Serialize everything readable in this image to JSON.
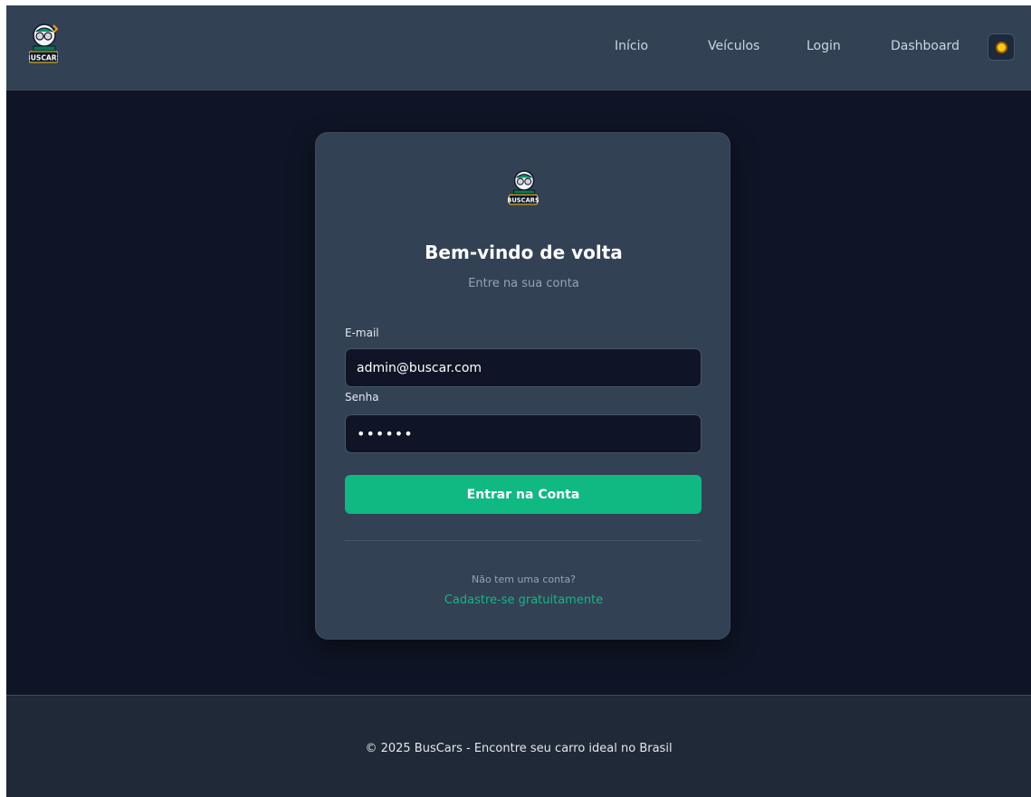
{
  "brand": {
    "logo_text": "BUSCARS"
  },
  "nav": {
    "items": [
      {
        "label": "Início"
      },
      {
        "label": "Veículos"
      },
      {
        "label": "Login"
      },
      {
        "label": "Dashboard"
      }
    ],
    "theme_icon": "sun-icon"
  },
  "login": {
    "title": "Bem-vindo de volta",
    "subtitle": "Entre na sua conta",
    "email_label": "E-mail",
    "email_value": "admin@buscar.com",
    "password_label": "Senha",
    "password_value": "••••••",
    "submit_label": "Entrar na Conta",
    "no_account_text": "Não tem uma conta?",
    "signup_link": "Cadastre-se gratuitamente"
  },
  "footer": {
    "text": "© 2025 BusCars - Encontre seu carro ideal no Brasil"
  },
  "colors": {
    "accent": "#10b981",
    "header_bg": "#334155",
    "page_bg": "#0f1526",
    "card_bg": "#334155"
  }
}
